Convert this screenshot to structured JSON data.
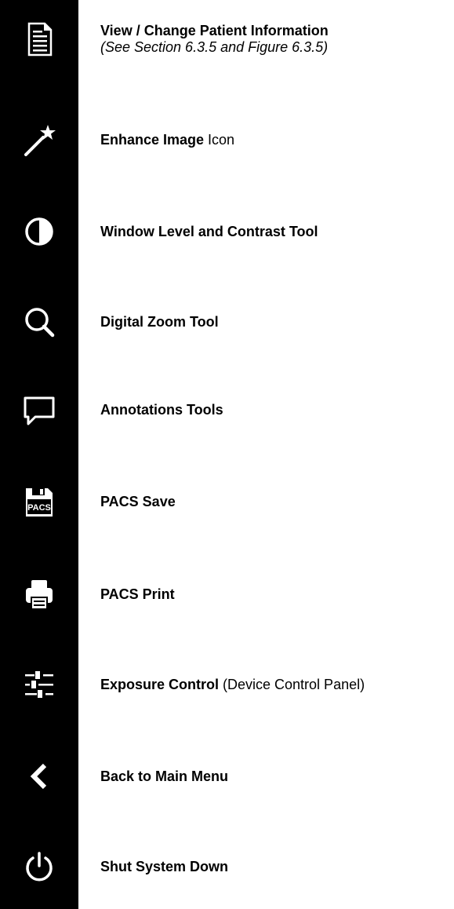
{
  "items": [
    {
      "icon": "document-icon",
      "bold": "View / Change Patient Information",
      "rest": "",
      "sub": "(See Section 6.3.5 and Figure 6.3.5)"
    },
    {
      "icon": "magic-wand-icon",
      "bold": "Enhance Image",
      "rest": " Icon",
      "sub": ""
    },
    {
      "icon": "contrast-icon",
      "bold": "Window Level and Contrast Tool",
      "rest": "",
      "sub": ""
    },
    {
      "icon": "magnifier-icon",
      "bold": "Digital Zoom Tool",
      "rest": "",
      "sub": ""
    },
    {
      "icon": "speech-bubble-icon",
      "bold": "Annotations Tools",
      "rest": "",
      "sub": ""
    },
    {
      "icon": "floppy-pacs-icon",
      "bold": "PACS Save",
      "rest": "",
      "sub": "",
      "icon_text": "PACS"
    },
    {
      "icon": "printer-icon",
      "bold": "PACS Print",
      "rest": "",
      "sub": ""
    },
    {
      "icon": "sliders-icon",
      "bold": "Exposure Control",
      "rest": " (Device Control Panel)",
      "sub": ""
    },
    {
      "icon": "chevron-left-icon",
      "bold": "Back to Main Menu",
      "rest": "",
      "sub": ""
    },
    {
      "icon": "power-icon",
      "bold": "Shut System Down",
      "rest": "",
      "sub": ""
    }
  ],
  "colors": {
    "sidebar": "#000000",
    "icon": "#ffffff",
    "text": "#000000",
    "background": "#ffffff"
  }
}
